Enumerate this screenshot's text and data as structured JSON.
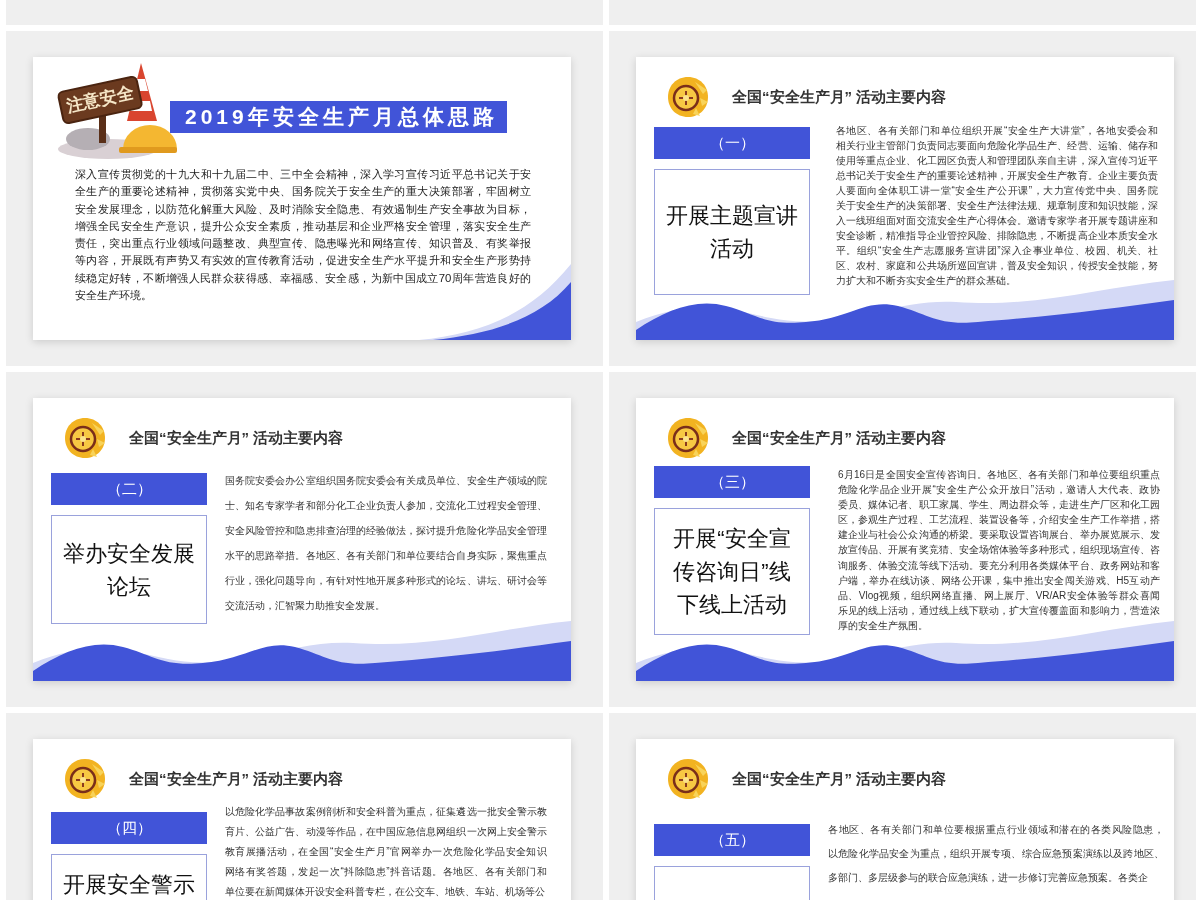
{
  "slides": [
    {
      "kind": "overview",
      "sign_text": "注意安全",
      "title": "2019年安全生产月总体思路",
      "lines": [
        "深入宣传贯彻党的十九大和十九届二中、三中全会精神，深入学习宣传习近平总书记关于安",
        "全生产的重要论述精神，贯彻落实党中央、国务院关于安全生产的重大决策部署，牢固树立",
        "安全发展理念，以防范化解重大风险、及时消除安全隐患、有效遏制生产安全事故为目标，",
        "增强全民安全生产意识，提升公众安全素质，推动基层和企业严格安全管理，落实安全生产",
        "责任，突出重点行业领域问题整改、典型宣传、隐患曝光和网络宣传、知识普及、有奖举报",
        "等内容，开展既有声势又有实效的宣传教育活动，促进安全生产水平提升和安全生产形势持",
        "续稳定好转，不断增强人民群众获得感、幸福感、安全感，为新中国成立70周年营造良好的",
        "安全生产环境。"
      ]
    },
    {
      "kind": "activity",
      "heading": "全国“安全生产月” 活动主要内容",
      "number": "（一）",
      "title_lines": [
        "开展主题宣讲",
        "活动"
      ],
      "lines": [
        "各地区、各有关部门和单位组织开展“安全生产大讲堂”，各地安委会和",
        "相关行业主管部门负责同志要面向危险化学品生产、经营、运输、储存和",
        "使用等重点企业、化工园区负责人和管理团队亲自主讲，深入宣传习近平",
        "总书记关于安全生产的重要论述精神，开展安全生产教育。企业主要负责",
        "人要面向全体职工讲一堂“安全生产公开课”，大力宣传党中央、国务院",
        "关于安全生产的决策部署、安全生产法律法规、规章制度和知识技能，深",
        "入一线班组面对面交流安全生产心得体会。邀请专家学者开展专题讲座和",
        "安全诊断，精准指导企业管控风险、排除隐患，不断提高企业本质安全水",
        "平。组织“安全生产志愿服务宣讲团”深入企事业单位、校园、机关、社",
        "区、农村、家庭和公共场所巡回宣讲，普及安全知识，传授安全技能，努",
        "力扩大和不断夯实安全生产的群众基础。"
      ]
    },
    {
      "kind": "activity",
      "heading": "全国“安全生产月” 活动主要内容",
      "number": "（二）",
      "title_lines": [
        "举办安全发展",
        "论坛"
      ],
      "lines": [
        "国务院安委会办公室组织国务院安委会有关成员单位、安全生产领域的院",
        "士、知名专家学者和部分化工企业负责人参加，交流化工过程安全管理、",
        "安全风险管控和隐患排查治理的经验做法，探讨提升危险化学品安全管理",
        "水平的思路举措。各地区、各有关部门和单位要结合自身实际，聚焦重点",
        "行业，强化问题导向，有针对性地开展多种形式的论坛、讲坛、研讨会等",
        "交流活动，汇智聚力助推安全发展。"
      ]
    },
    {
      "kind": "activity",
      "heading": "全国“安全生产月” 活动主要内容",
      "number": "（三）",
      "title_lines": [
        "开展“安全宣",
        "传咨询日”线",
        "下线上活动"
      ],
      "lines": [
        "6月16日是全国安全宣传咨询日。各地区、各有关部门和单位要组织重点",
        "危险化学品企业开展“安全生产公众开放日”活动，邀请人大代表、政协",
        "委员、媒体记者、职工家属、学生、周边群众等，走进生产厂区和化工园",
        "区，参观生产过程、工艺流程、装置设备等，介绍安全生产工作举措，搭",
        "建企业与社会公众沟通的桥梁。要采取设置咨询展台、举办展览展示、发",
        "放宣传品、开展有奖竞猜、安全场馆体验等多种形式，组织现场宣传、咨",
        "询服务、体验交流等线下活动。要充分利用各类媒体平台、政务网站和客",
        "户端，举办在线访谈、网络公开课，集中推出安全闯关游戏、H5互动产",
        "品、Vlog视频，组织网络直播、网上展厅、VR/AR安全体验等群众喜闻",
        "乐见的线上活动，通过线上线下联动，扩大宣传覆盖面和影响力，营造浓",
        "厚的安全生产氛围。"
      ]
    },
    {
      "kind": "activity",
      "heading": "全国“安全生产月” 活动主要内容",
      "number": "（四）",
      "title_lines": [
        "开展安全警示"
      ],
      "lines": [
        "以危险化学品事故案例剖析和安全科普为重点，征集遴选一批安全警示教",
        "育片、公益广告、动漫等作品，在中国应急信息网组织一次网上安全警示",
        "教育展播活动，在全国“安全生产月”官网举办一次危险化学品安全知识",
        "网络有奖答题，发起一次“抖除隐患”抖音话题。各地区、各有关部门和",
        "单位要在新闻媒体开设安全科普专栏，在公交车、地铁、车站、机场等公"
      ]
    },
    {
      "kind": "activity",
      "heading": "全国“安全生产月” 活动主要内容",
      "number": "（五）",
      "lines": [
        "各地区、各有关部门和单位要根据重点行业领域和潜在的各类风险隐患，",
        "以危险化学品安全为重点，组织开展专项、综合应急预案演练以及跨地区、",
        "多部门、多层级参与的联合应急演练，进一步修订完善应急预案。各类企"
      ]
    }
  ]
}
